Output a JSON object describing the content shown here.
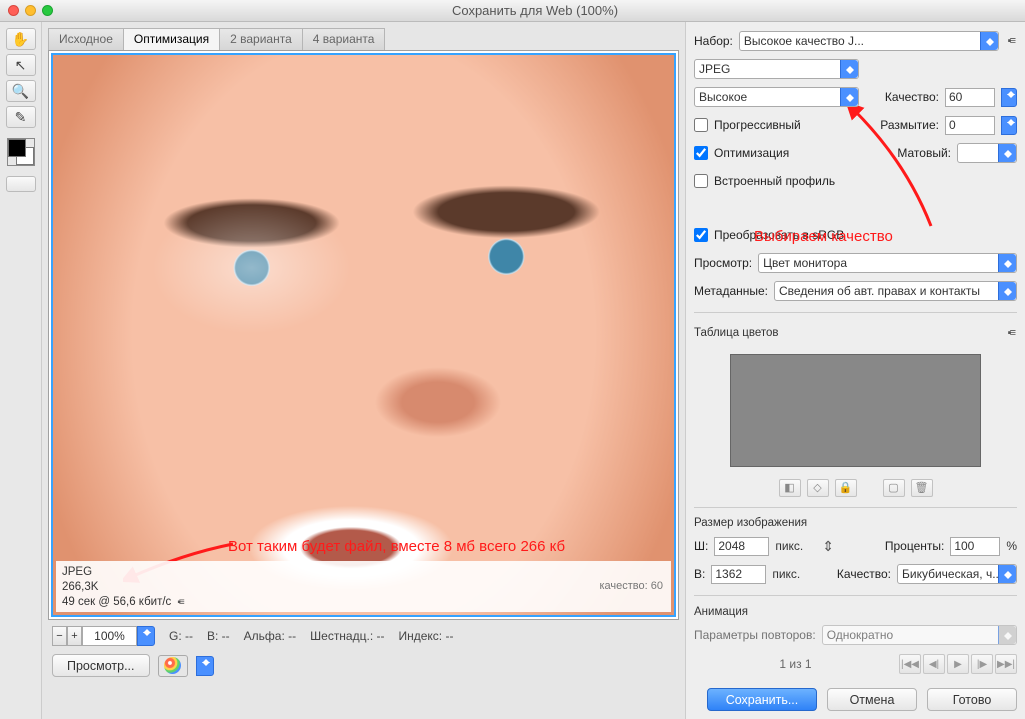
{
  "window": {
    "title": "Сохранить для Web (100%)"
  },
  "tabs": {
    "tab1": "Исходное",
    "tab2": "Оптимизация",
    "tab3": "2 варианта",
    "tab4": "4 варианта"
  },
  "preview_info": {
    "format": "JPEG",
    "size": "266,3K",
    "time": "49 сек @ 56,6 кбит/с",
    "quality_line": "качество: 60"
  },
  "annotation1": "Вот таким будет файл, вместе 8 мб всего 266 кб",
  "annotation2": "Выбираем качество",
  "statusbar": {
    "zoom": "100%",
    "g": "G: --",
    "b": "B: --",
    "alpha": "Альфа: --",
    "hex": "Шестнадц.: --",
    "index": "Индекс: --"
  },
  "buttons": {
    "preview": "Просмотр...",
    "save": "Сохранить...",
    "cancel": "Отмена",
    "done": "Готово"
  },
  "preset": {
    "label": "Набор:",
    "value": "Высокое качество J...",
    "format": "JPEG",
    "quality_preset": "Высокое",
    "quality_label": "Качество:",
    "quality_value": "60",
    "progressive": "Прогрессивный",
    "blur_label": "Размытие:",
    "blur_value": "0",
    "optimize": "Оптимизация",
    "matte_label": "Матовый:",
    "embed": "Встроенный профиль",
    "srgb": "Преобразовать в sRGB",
    "view_label": "Просмотр:",
    "view_value": "Цвет монитора",
    "meta_label": "Метаданные:",
    "meta_value": "Сведения об авт. правах и контакты"
  },
  "color_table": {
    "title": "Таблица цветов"
  },
  "image_size": {
    "title": "Размер изображения",
    "w_label": "Ш:",
    "w_value": "2048",
    "h_label": "В:",
    "h_value": "1362",
    "px": "пикс.",
    "percent_label": "Проценты:",
    "percent_value": "100",
    "percent_sign": "%",
    "quality_label": "Качество:",
    "quality_value": "Бикубическая, ч..."
  },
  "animation": {
    "title": "Анимация",
    "loop_label": "Параметры повторов:",
    "loop_value": "Однократно",
    "page": "1 из 1"
  }
}
